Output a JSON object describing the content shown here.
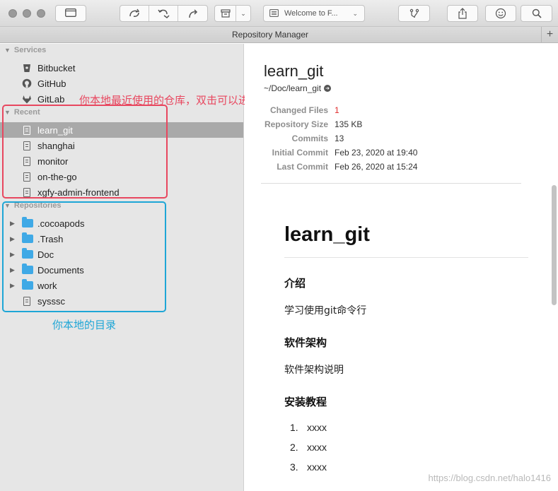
{
  "toolbar": {
    "welcome_label": "Welcome to F...",
    "icons": [
      "sidebar-icon",
      "fetch-icon",
      "pull-icon",
      "push-icon",
      "stash-icon",
      "branch-merge-icon",
      "share-icon",
      "smiley-icon",
      "search-icon"
    ]
  },
  "tabbar": {
    "title": "Repository Manager",
    "plus": "+"
  },
  "sidebar": {
    "services_header": "Services",
    "services": [
      {
        "label": "Bitbucket",
        "icon": "bitbucket-icon"
      },
      {
        "label": "GitHub",
        "icon": "github-icon"
      },
      {
        "label": "GitLab",
        "icon": "gitlab-icon"
      }
    ],
    "recent_header": "Recent",
    "recent": [
      {
        "label": "learn_git",
        "selected": true
      },
      {
        "label": "shanghai"
      },
      {
        "label": "monitor"
      },
      {
        "label": "on-the-go"
      },
      {
        "label": "xgfy-admin-frontend"
      }
    ],
    "repositories_header": "Repositories",
    "repositories": [
      {
        "label": ".cocoapods",
        "type": "folder"
      },
      {
        "label": ".Trash",
        "type": "folder"
      },
      {
        "label": "Doc",
        "type": "folder"
      },
      {
        "label": "Documents",
        "type": "folder"
      },
      {
        "label": "work",
        "type": "folder"
      },
      {
        "label": "sysssc",
        "type": "repo"
      }
    ]
  },
  "annotations": {
    "recent_note": "你本地最近使用的仓库，双击可以进入",
    "local_note": "你本地的目录",
    "recent_color": "#e8475f",
    "local_color": "#1ea6d6"
  },
  "main": {
    "repo_name": "learn_git",
    "repo_path": "~/Doc/learn_git",
    "stats": [
      {
        "key": "Changed Files",
        "value": "1",
        "highlight": true
      },
      {
        "key": "Repository Size",
        "value": "135 KB"
      },
      {
        "key": "Commits",
        "value": "13"
      },
      {
        "key": "Initial Commit",
        "value": "Feb 23, 2020 at 19:40"
      },
      {
        "key": "Last Commit",
        "value": "Feb 26, 2020 at 15:24"
      }
    ],
    "readme": {
      "h1": "learn_git",
      "s1_title": "介绍",
      "s1_body": "学习使用git命令行",
      "s2_title": "软件架构",
      "s2_body": "软件架构说明",
      "s3_title": "安装教程",
      "list": [
        {
          "n": "1.",
          "text": "xxxx"
        },
        {
          "n": "2.",
          "text": "xxxx"
        },
        {
          "n": "3.",
          "text": "xxxx"
        }
      ]
    }
  },
  "watermark": "https://blog.csdn.net/halo1416"
}
